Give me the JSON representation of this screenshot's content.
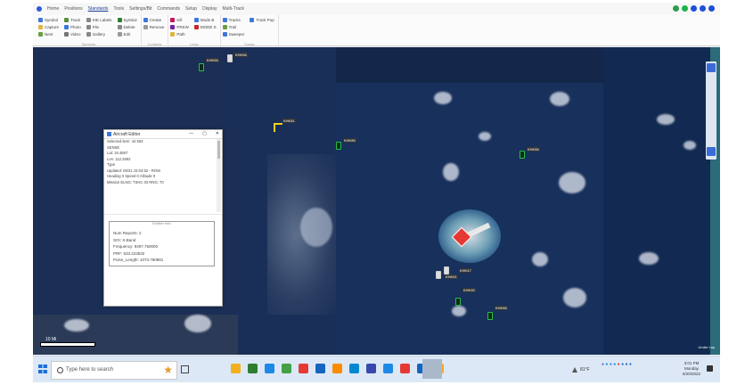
{
  "menu": {
    "items": [
      "Home",
      "Positions",
      "Standards",
      "Tools",
      "Settings/Bit",
      "Commands",
      "Setup",
      "Display",
      "Multi-Track"
    ],
    "active_index": 2
  },
  "ribbon": {
    "groups": [
      {
        "label": "Symbols",
        "buttons": [
          {
            "label": "Symbol",
            "icon": "star-icon",
            "color": "#3c78d8"
          },
          {
            "label": "Capture",
            "icon": "capture-icon",
            "color": "#e3b341"
          },
          {
            "label": "Next",
            "icon": "next-icon",
            "color": "#6a9f3f"
          },
          {
            "label": "Track",
            "icon": "track-icon",
            "color": "#5a8f3c"
          },
          {
            "label": "Photo",
            "icon": "photo-icon",
            "color": "#3c78d8"
          },
          {
            "label": "Video",
            "icon": "video-icon",
            "color": "#777777"
          },
          {
            "label": "KIE Labels",
            "icon": "labels-icon",
            "color": "#888888"
          },
          {
            "label": "File",
            "icon": "file-icon",
            "color": "#888888"
          },
          {
            "label": "Gallery",
            "icon": "gallery-icon",
            "color": "#888888"
          },
          {
            "label": "Symbol",
            "icon": "symbol-icon",
            "color": "#2e7d32"
          },
          {
            "label": "Delete",
            "icon": "delete-icon",
            "color": "#888888"
          },
          {
            "label": "Edit",
            "icon": "edit-icon",
            "color": "#999999"
          }
        ]
      },
      {
        "label": "Contacts",
        "buttons": [
          {
            "label": "Create",
            "icon": "create-icon",
            "color": "#3c78d8"
          },
          {
            "label": "Remove",
            "icon": "remove-icon",
            "color": "#999999"
          }
        ]
      },
      {
        "label": "Links",
        "buttons": [
          {
            "label": "Kill",
            "icon": "kill-icon",
            "color": "#c2185b"
          },
          {
            "label": "PRKW",
            "icon": "prkw-icon",
            "color": "#7b1fa2"
          },
          {
            "label": "Path",
            "icon": "path-icon",
            "color": "#e3b341"
          },
          {
            "label": "Mode B",
            "icon": "modeb-icon",
            "color": "#3c78d8"
          },
          {
            "label": "MODE S",
            "icon": "modes-icon",
            "color": "#c62828"
          }
        ]
      },
      {
        "label": "Tracks",
        "buttons": [
          {
            "label": "Tracks",
            "icon": "tracks-icon",
            "color": "#3c78d8"
          },
          {
            "label": "Trail",
            "icon": "trail-icon",
            "color": "#6a9f3f"
          },
          {
            "label": "Sweeper",
            "icon": "sweeper-icon",
            "color": "#3c78d8"
          },
          {
            "label": "Track Pop",
            "icon": "trackpop-icon",
            "color": "#3c78d8"
          }
        ]
      }
    ]
  },
  "top_icons": [
    {
      "name": "location-pin-icon",
      "color": "#2e9b4a"
    },
    {
      "name": "status-green-icon",
      "color": "#1fb24a"
    },
    {
      "name": "account-icon",
      "color": "#1d4fd8"
    },
    {
      "name": "settings-icon",
      "color": "#1d4fd8"
    },
    {
      "name": "help-icon",
      "color": "#1d4fd8"
    }
  ],
  "popup": {
    "title": "Aircraft Editor",
    "close": "✕",
    "info_lines": [
      "Selected item: 44 553",
      "SENSE",
      "Lat: 16.4667",
      "Lon: 112.2692",
      "Type",
      "Updated: 05/21 15:04:52 - ROW",
      "Heading 0 Speed 0 Altitude 0",
      "Mission ELNG: TSHC 03 RNG: 70"
    ],
    "emitter_title": "Emitter Info",
    "emitter_lines": [
      "Num Reports: 2",
      "SOI: X-Band",
      "Frequency: 9497.750000",
      "PRF: 533.223532",
      "Pulse_Length: 1073.780881"
    ]
  },
  "map": {
    "labels": [
      "KHK56",
      "KHK56",
      "KHK81",
      "KHK85",
      "KHK56",
      "KHK47",
      "KHK90",
      "KHK88",
      "KHK61"
    ],
    "scale_label": "10 Mi",
    "attribution": "Under Lay"
  },
  "taskbar": {
    "search_placeholder": "Type here to search",
    "weather": "81°F",
    "time": "3:01 PM",
    "day": "Monday",
    "date": "6/20/2022",
    "app_colors": [
      "#f2b01e",
      "#2e7d32",
      "#1e88e5",
      "#43a047",
      "#e53935",
      "#1565c0",
      "#fb8c00",
      "#0288d1",
      "#3949ab",
      "#1e88e5",
      "#e53935",
      "#1565c0",
      "#f9a825"
    ]
  }
}
